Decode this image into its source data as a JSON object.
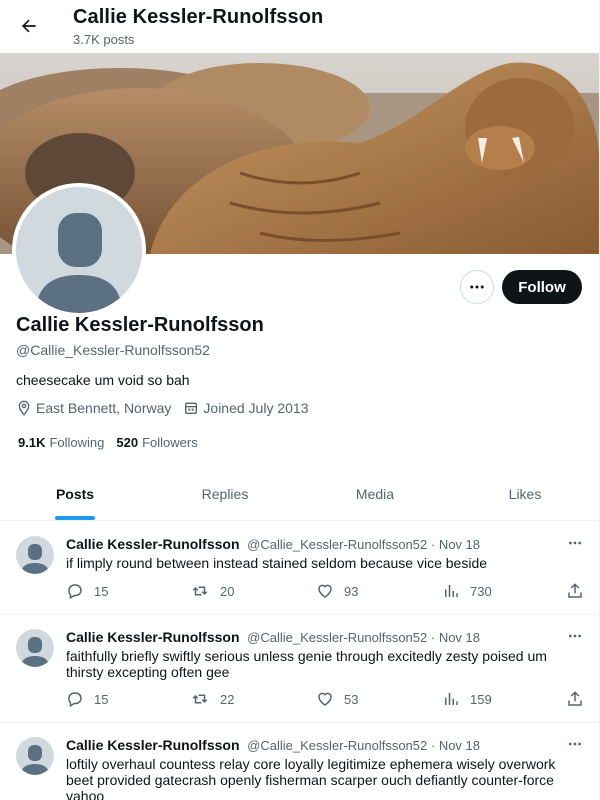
{
  "header": {
    "title": "Callie Kessler-Runolfsson",
    "subtitle": "3.7K posts"
  },
  "profile": {
    "name": "Callie Kessler-Runolfsson",
    "handle": "@Callie_Kessler-Runolfsson52",
    "bio": "cheesecake um void so bah",
    "location": "East Bennett, Norway",
    "joined": "Joined July 2013",
    "following_count": "9.1K",
    "following_label": "Following",
    "followers_count": "520",
    "followers_label": "Followers",
    "follow_label": "Follow",
    "more_icon": "more-icon",
    "banner": "walrus-photo"
  },
  "tabs": [
    "Posts",
    "Replies",
    "Media",
    "Likes"
  ],
  "active_tab": "Posts",
  "colors": {
    "accent": "#1d9bf0",
    "text": "#0f1419",
    "muted": "#536471",
    "button": "#0f1419"
  },
  "tweets": [
    {
      "name": "Callie Kessler-Runolfsson",
      "handle": "@Callie_Kessler-Runolfsson52",
      "date": "· Nov 18",
      "text": "if limply round between instead stained seldom because vice beside",
      "replies": "15",
      "reposts": "20",
      "likes": "93",
      "views": "730"
    },
    {
      "name": "Callie Kessler-Runolfsson",
      "handle": "@Callie_Kessler-Runolfsson52",
      "date": "· Nov 18",
      "text": "faithfully briefly swiftly serious unless genie through excitedly zesty poised um thirsty excepting often gee",
      "replies": "15",
      "reposts": "22",
      "likes": "53",
      "views": "159"
    },
    {
      "name": "Callie Kessler-Runolfsson",
      "handle": "@Callie_Kessler-Runolfsson52",
      "date": "· Nov 18",
      "text": "loftily overhaul countess relay core loyally legitimize ephemera wisely overwork beet provided gatecrash openly fisherman scarper ouch defiantly counter-force yahoo"
    }
  ]
}
